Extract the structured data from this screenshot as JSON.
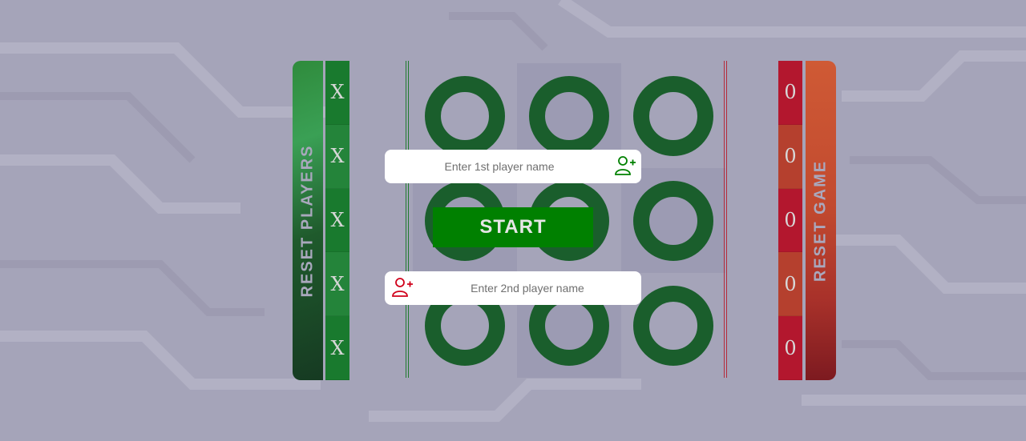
{
  "left_panel": {
    "label": "RESET PLAYERS"
  },
  "right_panel": {
    "label": "RESET GAME"
  },
  "player_x": {
    "marks": [
      "X",
      "X",
      "X",
      "X",
      "X"
    ]
  },
  "player_o": {
    "marks": [
      "0",
      "0",
      "0",
      "0",
      "0"
    ]
  },
  "player1": {
    "placeholder": "Enter 1st player name",
    "icon": "add-user-icon",
    "color": "#008000"
  },
  "player2": {
    "placeholder": "Enter 2nd player name",
    "icon": "add-user-icon",
    "color": "#d0021b"
  },
  "start_button": {
    "label": "START",
    "color": "#008000"
  },
  "board_colors": {
    "ring": "#1a5e2c",
    "x_strip": "#197a2e",
    "o_strip": "#b3172e"
  }
}
